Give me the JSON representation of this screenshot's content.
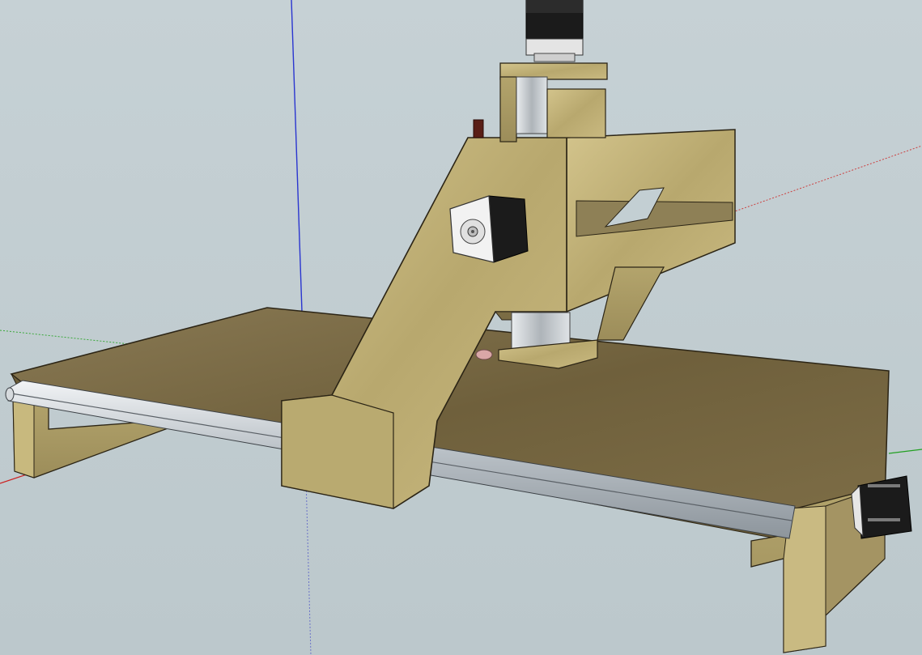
{
  "scene": {
    "background_color": "#c3cfd3",
    "wood_light_color": "#c4b47c",
    "wood_dark_color": "#7a6b45",
    "rail_color": "#bfc5cb",
    "motor_color": "#1b1b1b",
    "axis_blue_color": "#2a35d0",
    "axis_red_color": "#cc2020",
    "axis_green_color": "#22a022"
  }
}
